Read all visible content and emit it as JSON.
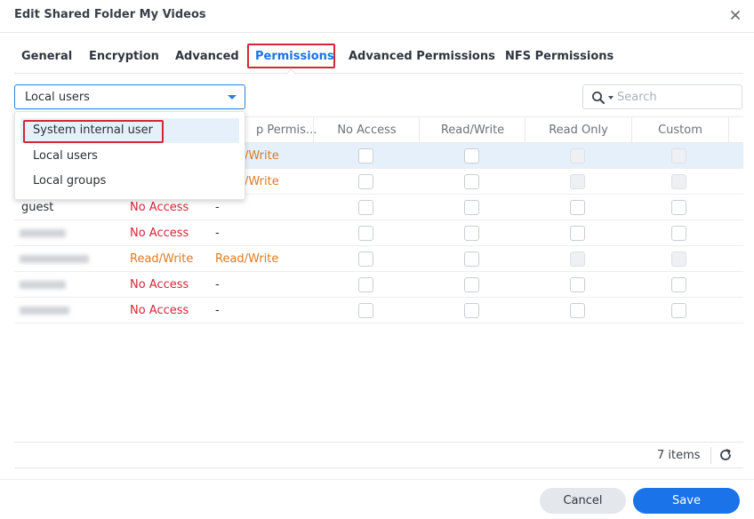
{
  "window": {
    "title": "Edit Shared Folder My Videos"
  },
  "tabs": [
    {
      "label": "General"
    },
    {
      "label": "Encryption"
    },
    {
      "label": "Advanced"
    },
    {
      "label": "Permissions"
    },
    {
      "label": "Advanced Permissions"
    },
    {
      "label": "NFS Permissions"
    }
  ],
  "user_type_select": {
    "value": "Local users",
    "options": [
      "System internal user",
      "Local users",
      "Local groups"
    ]
  },
  "search": {
    "placeholder": "Search"
  },
  "table": {
    "columns": [
      "p Permis...",
      "No Access",
      "Read/Write",
      "Read Only",
      "Custom"
    ],
    "rows": [
      {
        "name": "",
        "preview": "",
        "group": "/Write",
        "selected": true
      },
      {
        "name": "",
        "preview": "",
        "group": "/Write",
        "selected": false
      },
      {
        "name": "guest",
        "preview": "No Access",
        "group": "-",
        "selected": false
      },
      {
        "name": "",
        "preview": "No Access",
        "group": "-",
        "selected": false
      },
      {
        "name": "",
        "preview": "Read/Write",
        "group": "Read/Write",
        "selected": false
      },
      {
        "name": "",
        "preview": "No Access",
        "group": "-",
        "selected": false
      },
      {
        "name": "",
        "preview": "No Access",
        "group": "-",
        "selected": false
      }
    ]
  },
  "footer": {
    "count": "7 items"
  },
  "buttons": {
    "cancel": "Cancel",
    "save": "Save"
  },
  "colors": {
    "accent": "#1a73e8",
    "highlight_outline": "#d42636",
    "no_access": "#d42636",
    "read_write": "#e07a1f"
  }
}
